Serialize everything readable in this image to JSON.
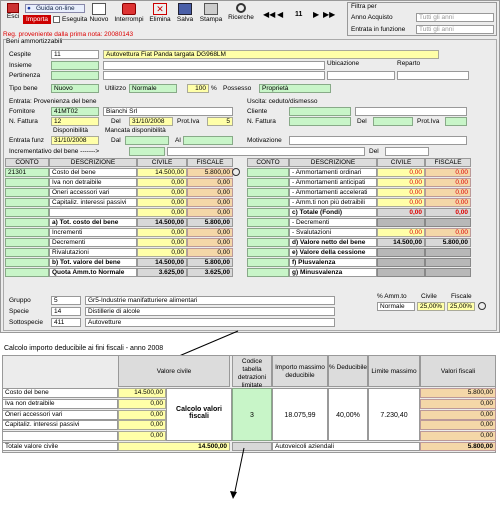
{
  "toolbar": {
    "esc": "Esci",
    "importa": "Importa",
    "eseguita": "Eseguita",
    "guida": "Guida on-line",
    "nuovo": "Nuovo",
    "interrompi": "Interrompi",
    "elimina": "Elimina",
    "salva": "Salva",
    "stampa": "Stampa",
    "ricerche": "Ricerche",
    "page": "11"
  },
  "filter": {
    "title": "Filtra per",
    "anno_label": "Anno Acquisto",
    "anno_value": "Tutti gli anni",
    "entrata_label": "Entrata in funzione",
    "entrata_value": "Tutti gli anni"
  },
  "reg_note": "Reg. proveniente dalla prima nota: 20080143",
  "beni": {
    "section": "Beni ammortizzabili",
    "cespite_label": "Cespite",
    "cespite_code": "11",
    "cespite_desc": "Autovettura Fiat Panda targata DG968LM",
    "insieme_label": "Insieme",
    "pertinenza_label": "Pertinenza",
    "ubicazione_label": "Ubicazione",
    "reparto_label": "Reparto",
    "tipo_label": "Tipo bene",
    "tipo_value": "Nuovo",
    "utilizzo_label": "Utilizzo",
    "utilizzo_value": "Normale",
    "perc_value": "100",
    "perc_sign": "%",
    "possesso_label": "Possesso",
    "possesso_value": "Proprietà"
  },
  "entrata": {
    "label": "Entrata: Provenienza del bene",
    "fornitore_label": "Fornitore",
    "fornitore_code": "41MT02",
    "fornitore_name": "Bianchi Srl",
    "nfatt_label": "N. Fattura",
    "nfatt_value": "12",
    "del_label": "Del",
    "del_value": "31/10/2008",
    "protiva_label": "Prot.Iva",
    "protiva_value": "5",
    "uscita_label": "Uscita: ceduto/dismesso",
    "cliente_label": "Cliente",
    "nfatt2_label": "N. Fattura",
    "del2_label": "Del",
    "protiva2_label": "Prot.Iva",
    "disp_label": "Disponibilità",
    "mancata_label": "Mancata disponibilità",
    "entrata_funz_label": "Entrata funz",
    "entrata_funz_value": "31/10/2008",
    "dal_label": "Dal",
    "al_label": "Al",
    "motivazione_label": "Motivazione",
    "incr_label": "Incrementativo del bene ------->",
    "incr_del_label": "Del"
  },
  "left_table": {
    "headers": [
      "CONTO",
      "DESCRIZIONE",
      "CIVILE",
      "FISCALE"
    ],
    "rows": [
      {
        "conto": "21301",
        "desc": "Costo del bene",
        "civile": "14.500,00",
        "fiscale": "5.800,00"
      },
      {
        "conto": "",
        "desc": "Iva non detraibile",
        "civile": "0,00",
        "fiscale": "0,00"
      },
      {
        "conto": "",
        "desc": "Oneri accessori vari",
        "civile": "0,00",
        "fiscale": "0,00"
      },
      {
        "conto": "",
        "desc": "Capitaliz. interessi passivi",
        "civile": "0,00",
        "fiscale": "0,00"
      },
      {
        "conto": "",
        "desc": "",
        "civile": "0,00",
        "fiscale": "0,00"
      },
      {
        "conto": "",
        "desc": "a) Tot. costo del bene",
        "civile": "14.500,00",
        "fiscale": "5.800,00"
      },
      {
        "conto": "",
        "desc": "Incrementi",
        "civile": "0,00",
        "fiscale": "0,00"
      },
      {
        "conto": "",
        "desc": "Decrementi",
        "civile": "0,00",
        "fiscale": "0,00"
      },
      {
        "conto": "",
        "desc": "Rivalutazioni",
        "civile": "0,00",
        "fiscale": "0,00"
      },
      {
        "conto": "",
        "desc": "b) Tot. valore del bene",
        "civile": "14.500,00",
        "fiscale": "5.800,00"
      },
      {
        "conto": "",
        "desc": "Quota Amm.to Normale",
        "civile": "3.625,00",
        "fiscale": "3.625,00"
      }
    ]
  },
  "right_table": {
    "headers": [
      "CONTO",
      "DESCRIZIONE",
      "CIVILE",
      "FISCALE"
    ],
    "rows": [
      {
        "desc": "- Ammortamenti ordinari",
        "civile": "0,00",
        "fiscale": "0,00"
      },
      {
        "desc": "- Ammortamenti anticipati",
        "civile": "0,00",
        "fiscale": "0,00"
      },
      {
        "desc": "- Ammortamenti accelerati",
        "civile": "0,00",
        "fiscale": "0,00"
      },
      {
        "desc": "- Amm.ti non più detraibili",
        "civile": "0,00",
        "fiscale": "0,00"
      },
      {
        "desc": "c) Totale (Fondi)",
        "civile": "0,00",
        "fiscale": "0,00"
      },
      {
        "desc": "- Decrementi",
        "civile": "",
        "fiscale": ""
      },
      {
        "desc": "- Svalutazioni",
        "civile": "0,00",
        "fiscale": "0,00"
      },
      {
        "desc": "d) Valore netto del bene",
        "civile": "14.500,00",
        "fiscale": "5.800,00"
      },
      {
        "desc": "e) Valore della cessione",
        "civile": "",
        "fiscale": ""
      },
      {
        "desc": "f) Plusvalenza",
        "civile": "",
        "fiscale": ""
      },
      {
        "desc": "g) Minusvalenza",
        "civile": "",
        "fiscale": ""
      }
    ]
  },
  "gruppo": {
    "gruppo_label": "Gruppo",
    "gruppo_code": "5",
    "gruppo_desc": "Gr5-Industrie manifatturiere alimentari",
    "specie_label": "Specie",
    "specie_code": "14",
    "specie_desc": "Distillerie di alcole",
    "sotto_label": "Sottospecie",
    "sotto_code": "411",
    "sotto_desc": "Autovetture",
    "amm_label": "% Amm.to",
    "civile_label": "Civile",
    "fiscale_label": "Fiscale",
    "amm_type": "Normale",
    "civile_pct": "25,00%",
    "fiscale_pct": "25,00%"
  },
  "calc": {
    "title": "Calcolo importo deducibile ai fini fiscali - anno 2008",
    "h_civile": "Valore civile",
    "h_codice": "Codice tabella detrazioni limitate",
    "h_importo": "Importo massimo deducibile",
    "h_perc": "% Deducibile",
    "h_limite": "Limite massimo",
    "h_fiscali": "Valori fiscali",
    "rows": [
      {
        "desc": "Costo del bene",
        "civile": "14.500,00",
        "fiscale": "5.800,00"
      },
      {
        "desc": "Iva non detraibile",
        "civile": "0,00",
        "fiscale": "0,00"
      },
      {
        "desc": "Oneri accessori vari",
        "civile": "0,00",
        "fiscale": "0,00"
      },
      {
        "desc": "Capitaliz. interessi passivi",
        "civile": "0,00",
        "fiscale": "0,00"
      },
      {
        "desc": "",
        "civile": "0,00",
        "fiscale": "0,00"
      }
    ],
    "mid_label": "Calcolo valori fiscali",
    "codice": "3",
    "importo": "18.075,99",
    "perc": "40,00%",
    "limite": "7.230,40",
    "total_label": "Totale valore civile",
    "total_civile": "14.500,00",
    "total_desc": "Autoveicoli aziendali",
    "total_fiscale": "5.800,00"
  },
  "colors": {
    "accent_red": "#cc0000",
    "green": "#c8f5c8",
    "yellow": "#ffffa8",
    "orange": "#f4d7a8"
  }
}
